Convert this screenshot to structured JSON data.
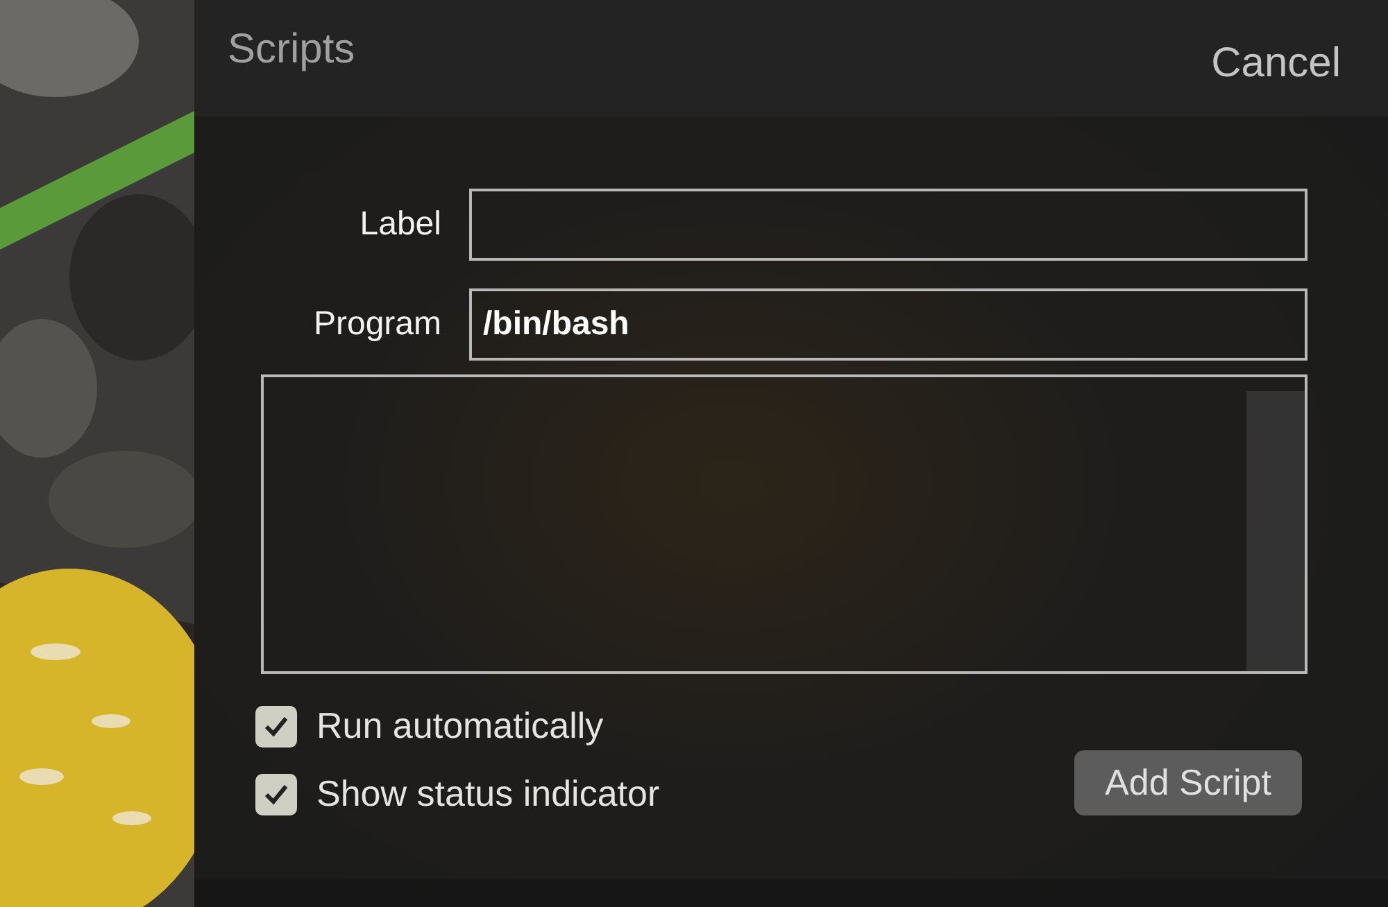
{
  "dialog": {
    "title": "Scripts",
    "cancel": "Cancel",
    "fields": [
      {
        "label": "Label"
      },
      {
        "label": "Program",
        "value": "/bin/bash"
      }
    ],
    "options": [
      {
        "label": "Run automatically",
        "checked": true
      },
      {
        "label": "Show status indicator",
        "checked": true
      }
    ],
    "add_button": "Add Script"
  }
}
